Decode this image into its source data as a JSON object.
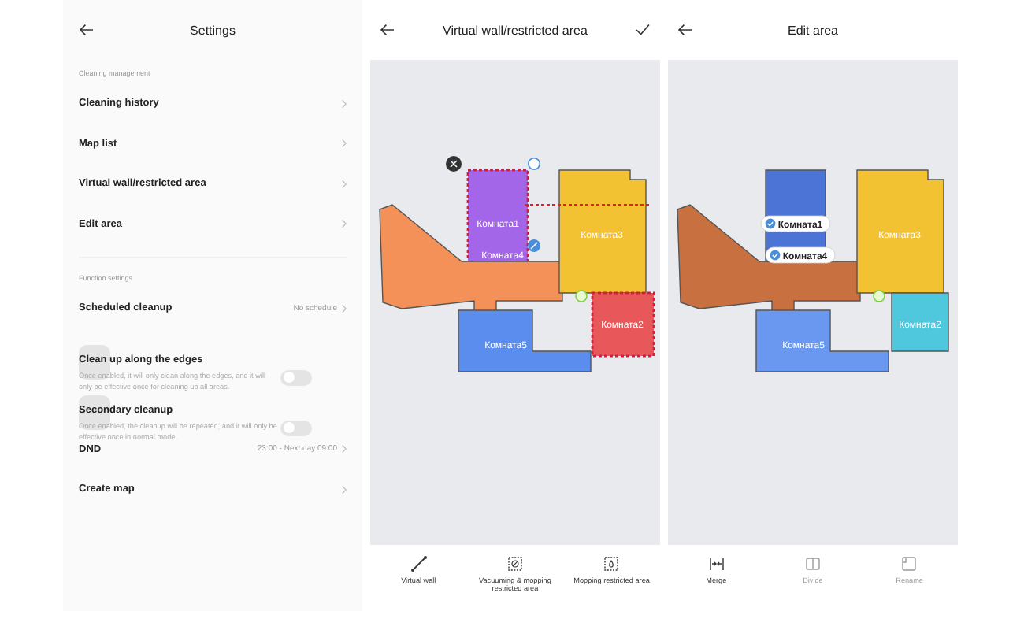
{
  "settings": {
    "title": "Settings",
    "sections": [
      {
        "heading": "Cleaning management",
        "items": [
          {
            "kind": "link",
            "label": "Cleaning history"
          },
          {
            "kind": "link",
            "label": "Map list"
          },
          {
            "kind": "link",
            "label": "Virtual wall/restricted area"
          },
          {
            "kind": "link",
            "label": "Edit area"
          }
        ]
      },
      {
        "heading": "Function settings",
        "items": [
          {
            "kind": "link",
            "label": "Scheduled cleanup",
            "value": "No schedule"
          },
          {
            "kind": "toggle",
            "label": "Clean up along the edges",
            "description": "Once enabled, it will only clean along the edges, and it will only be effective once for cleaning up all areas.",
            "on": false
          },
          {
            "kind": "toggle",
            "label": "Secondary cleanup",
            "description": "Once enabled, the cleanup will be repeated, and it will only be effective once in normal mode.",
            "on": false
          },
          {
            "kind": "link",
            "label": "DND",
            "value": "23:00 - Next day 09:00"
          },
          {
            "kind": "link",
            "label": "Create map"
          }
        ]
      }
    ]
  },
  "restricted_area_screen": {
    "title": "Virtual wall/restricted area",
    "rooms": [
      {
        "name": "Комната1",
        "color": "#a466e8",
        "restricted": true
      },
      {
        "name": "Комната4",
        "color": "#f39158",
        "restricted": false
      },
      {
        "name": "Комната3",
        "color": "#f3c232",
        "restricted": false
      },
      {
        "name": "Комната2",
        "color": "#e8585a",
        "restricted": true
      },
      {
        "name": "Комната5",
        "color": "#5b8def",
        "restricted": false
      }
    ],
    "tools": [
      {
        "kind": "wall",
        "label": "Virtual wall"
      },
      {
        "kind": "zone",
        "label": "Vacuuming & mopping restricted area"
      },
      {
        "kind": "mop",
        "label": "Mopping restricted area"
      }
    ]
  },
  "edit_area_screen": {
    "title": "Edit area",
    "rooms": [
      {
        "name": "Комната1",
        "color": "#4b74d6",
        "selected": true
      },
      {
        "name": "Комната4",
        "color": "#c8703f",
        "selected": true
      },
      {
        "name": "Комната3",
        "color": "#f3c232",
        "selected": false
      },
      {
        "name": "Комната2",
        "color": "#4fc7dc",
        "selected": false
      },
      {
        "name": "Комната5",
        "color": "#6a98f0",
        "selected": false
      }
    ],
    "tools": [
      {
        "kind": "merge",
        "label": "Merge",
        "disabled": false
      },
      {
        "kind": "divide",
        "label": "Divide",
        "disabled": true
      },
      {
        "kind": "rename",
        "label": "Rename",
        "disabled": true
      }
    ]
  }
}
